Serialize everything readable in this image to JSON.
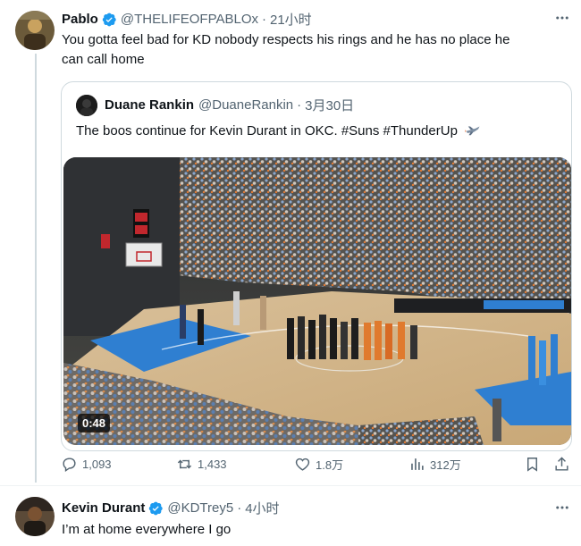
{
  "tweet": {
    "display_name": "Pablo",
    "handle": "@THELIFEOFPABLOx",
    "time": "21小时",
    "dot": "·",
    "text_line1": "You gotta feel bad for KD nobody respects his rings and he has no place he",
    "text_line2": "can call home",
    "quote": {
      "display_name": "Duane Rankin",
      "handle": "@DuaneRankin",
      "time": "3月30日",
      "dot": "·",
      "text": "The boos continue for Kevin Durant in OKC. #Suns #ThunderUp",
      "video_duration": "0:48"
    },
    "actions": {
      "replies": "1,093",
      "reposts": "1,433",
      "likes": "1.8万",
      "views": "312万"
    }
  },
  "reply": {
    "display_name": "Kevin Durant",
    "handle": "@KDTrey5",
    "time": "4小时",
    "dot": "·",
    "text": "I’m at home everywhere I go"
  },
  "icons": {
    "verified": "verified-badge-icon",
    "more": "more-options-icon",
    "reply": "reply-icon",
    "repost": "repost-icon",
    "like": "heart-icon",
    "views": "views-chart-icon",
    "bookmark": "bookmark-icon",
    "share": "share-icon",
    "jet": "jet-emoji-icon"
  },
  "colors": {
    "verified": "#1d9bf0",
    "secondary_text": "#536471",
    "border": "#cfd9de"
  }
}
